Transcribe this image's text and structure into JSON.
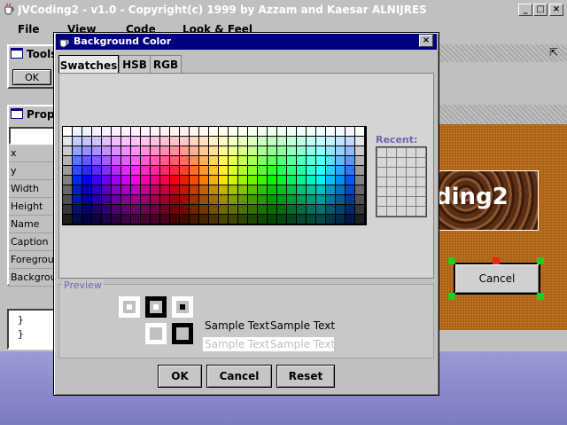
{
  "app": {
    "title": "JVCoding2 - v1.0 - Copyright(c) 1999 by Azzam and Kaesar ALNIJRES",
    "menu": [
      "File",
      "View",
      "Code",
      "Look & Feel"
    ]
  },
  "tools_panel": {
    "title": "Tools",
    "ok_label": "OK"
  },
  "properties_panel": {
    "title": "Prop",
    "rows": [
      "x",
      "y",
      "Width",
      "Height",
      "Name",
      "Caption",
      "Foregrou",
      "Backgrou"
    ]
  },
  "code_panel": {
    "lines": [
      "}",
      "}"
    ]
  },
  "canvas": {
    "banner_text": "ding2",
    "cancel_label": "Cancel"
  },
  "dialog": {
    "title": "Background Color",
    "tabs": [
      "Swatches",
      "HSB",
      "RGB"
    ],
    "active_tab": "Swatches",
    "recent_label": "Recent:",
    "preview_label": "Preview",
    "sample_text": "Sample Text",
    "buttons": {
      "ok": "OK",
      "cancel": "Cancel",
      "reset": "Reset"
    },
    "colors": {
      "accent_title": "#000080",
      "recent_label": "#6a6ab4",
      "canvas_bg": "#b06a1a"
    }
  }
}
